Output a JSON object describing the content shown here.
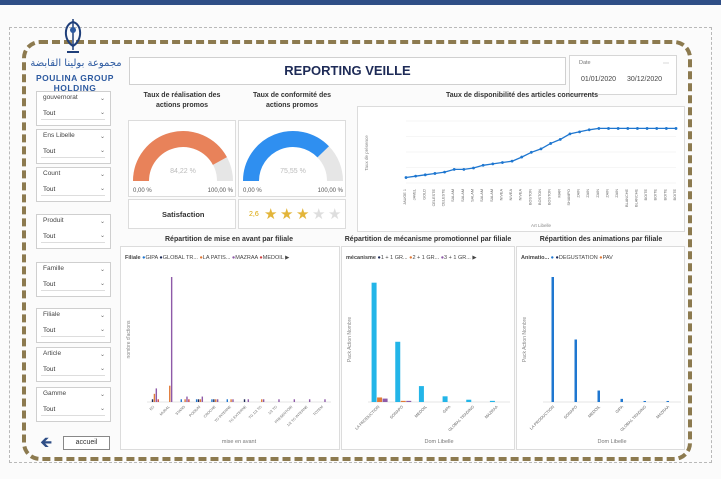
{
  "header": {
    "title": "REPORTING VEILLE",
    "logo_arabic": "مجموعة بولينا القابضة",
    "logo_english": "POULINA GROUP HOLDING"
  },
  "date_filter": {
    "label": "Date",
    "start": "01/01/2020",
    "end": "30/12/2020"
  },
  "filters": [
    {
      "label": "gouvernorat",
      "value": "Tout"
    },
    {
      "label": "Ens Libelle",
      "value": "Tout"
    },
    {
      "label": "Count",
      "value": "Tout"
    },
    {
      "label": "Produit",
      "value": "Tout"
    },
    {
      "label": "Famille",
      "value": "Tout"
    },
    {
      "label": "Filiale",
      "value": "Tout"
    },
    {
      "label": "Article",
      "value": "Tout"
    },
    {
      "label": "Gamme",
      "value": "Tout"
    }
  ],
  "nav": {
    "back_icon": "arrow-left-icon",
    "home_label": "accueil"
  },
  "gauges": [
    {
      "title": "Taux de réalisation des actions promos",
      "value": 84.22,
      "value_label": "84,22 %",
      "min_label": "0,00 %",
      "max_label": "100,00 %",
      "color": "#e8825a"
    },
    {
      "title": "Taux de conformité des actions promos",
      "value": 75.55,
      "value_label": "75,55 %",
      "min_label": "0,00 %",
      "max_label": "100,00 %",
      "color": "#2f8ff0"
    }
  ],
  "satisfaction": {
    "label": "Satisfaction",
    "score_label": "2,6",
    "rating": 2.6,
    "max": 5
  },
  "colors": {
    "accent_blue": "#1f77d0",
    "bar_cyan": "#23b5e8",
    "bar_purple": "#8e5aa8",
    "bar_orange": "#e07b39",
    "header_blue": "#2f4e86"
  },
  "charts": {
    "availability_title": "Taux de disponibilité des articles concurrents",
    "filiale_title": "Répartition de mise en avant par filiale",
    "mecanisme_title": "Répartition de mécanisme promotionnel par filiale",
    "animations_title": "Répartition  des animations  par filiale"
  },
  "legends": {
    "filiale": {
      "label": "Filiale",
      "items": [
        "GIPA",
        "GLOBAL TR...",
        "LA PATIS...",
        "MAZRAA",
        "MEDOIL"
      ]
    },
    "mecanisme": {
      "label": "mécanisme",
      "items": [
        "1 + 1 GR...",
        "2 + 1 GR...",
        "3 + 1 GR..."
      ]
    },
    "animations": {
      "label": "Animatio...",
      "items": [
        "",
        "DEGUSTATION",
        "PAV"
      ]
    }
  },
  "chart_data": [
    {
      "type": "line",
      "title": "Taux de disponibilité des articles concurrents",
      "xlabel": "Art Libelle",
      "ylabel": "Taux de présence",
      "ylim": [
        0,
        1
      ],
      "x": [
        "JAUGE 1",
        "JAVEL",
        "GOLD",
        "CELESTE",
        "CELESTE",
        "SALAM",
        "SALAM",
        "SALAM",
        "SALAM",
        "SALAM",
        "NIVEA",
        "NIVEA",
        "NIVEA",
        "BOSTON",
        "BOSTON",
        "BOSTON",
        "MAR",
        "SHAMPO",
        "ZAIN",
        "ZAIN",
        "ZAIN",
        "ZAIN",
        "ZAIN",
        "BLANCHE",
        "BLANCHE",
        "BOITE",
        "BOITE",
        "BOITE",
        "BOITE"
      ],
      "values": [
        0.08,
        0.1,
        0.12,
        0.14,
        0.16,
        0.2,
        0.2,
        0.22,
        0.26,
        0.28,
        0.3,
        0.32,
        0.38,
        0.45,
        0.5,
        0.58,
        0.64,
        0.72,
        0.75,
        0.78,
        0.8,
        0.8,
        0.8,
        0.8,
        0.8,
        0.8,
        0.8,
        0.8,
        0.8
      ]
    },
    {
      "type": "bar",
      "title": "Répartition de mise en avant par filiale",
      "xlabel": "mise en avant",
      "ylabel": "nombre d'actions",
      "categories": [
        "EG",
        "MURAL",
        "STAND",
        "PODIUM",
        "CROCHE",
        "TG INTERNE",
        "TG EXTERNE",
        "TG 1/2 TG",
        "1/2 TG",
        "PRESENTOIR",
        "1/2 TG INTERNE",
        "TOTEM"
      ],
      "series": [
        {
          "name": "GIPA",
          "values": [
            0,
            0,
            1,
            1,
            1,
            1,
            0,
            0,
            0,
            0,
            0,
            0
          ]
        },
        {
          "name": "GLOBAL TR...",
          "values": [
            1,
            0,
            0,
            1,
            1,
            0,
            1,
            0,
            0,
            0,
            0,
            0
          ]
        },
        {
          "name": "LA PATIS...",
          "values": [
            3,
            6,
            1,
            1,
            1,
            1,
            0,
            1,
            0,
            0,
            0,
            0
          ]
        },
        {
          "name": "MAZRAA",
          "values": [
            5,
            46,
            2,
            2,
            1,
            1,
            1,
            1,
            1,
            1,
            1,
            1
          ]
        },
        {
          "name": "MEDOIL",
          "values": [
            1,
            0,
            1,
            0,
            0,
            0,
            0,
            0,
            0,
            0,
            0,
            0
          ]
        }
      ]
    },
    {
      "type": "bar",
      "title": "Répartition de mécanisme promotionnel par filiale",
      "xlabel": "Dom Libelle",
      "ylabel": "Pack Action Nombre",
      "categories": [
        "LA PRODUCTION",
        "SONAPO",
        "MEDOIL",
        "GIPA",
        "GLOBAL TRADING",
        "MAZRAA"
      ],
      "series": [
        {
          "name": "1 + 1 GR...",
          "values": [
            105,
            53,
            14,
            5,
            2,
            1
          ]
        },
        {
          "name": "2 + 1 GR...",
          "values": [
            4,
            1,
            0,
            0,
            0,
            0
          ]
        },
        {
          "name": "3 + 1 GR...",
          "values": [
            3,
            1,
            0,
            0,
            0,
            0
          ]
        }
      ]
    },
    {
      "type": "bar",
      "title": "Répartition  des animations  par filiale",
      "xlabel": "Dom Libelle",
      "ylabel": "Pack Action Nombre",
      "categories": [
        "LA PRODUCTION",
        "SONAPO",
        "MEDOIL",
        "GIPA",
        "GLOBAL TRADING",
        "MAZRAA"
      ],
      "series": [
        {
          "name": "DEGUSTATION",
          "values": [
            120,
            60,
            11,
            3,
            1,
            1
          ]
        },
        {
          "name": "PAV",
          "values": [
            0,
            0,
            0,
            0,
            0,
            0
          ]
        }
      ]
    }
  ]
}
